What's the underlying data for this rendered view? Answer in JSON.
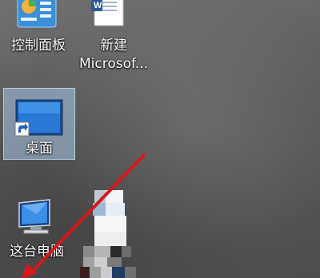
{
  "desktop": {
    "icons": [
      {
        "label": "控制面板",
        "icon": "control-panel-icon"
      },
      {
        "label": "新建",
        "label2": "Microsof...",
        "icon": "word-document-icon"
      },
      {
        "label": "桌面",
        "icon": "desktop-shortcut-icon"
      },
      {
        "label": "这台电脑",
        "icon": "computer-icon"
      }
    ],
    "annotation_arrow_color": "#d8171d"
  }
}
